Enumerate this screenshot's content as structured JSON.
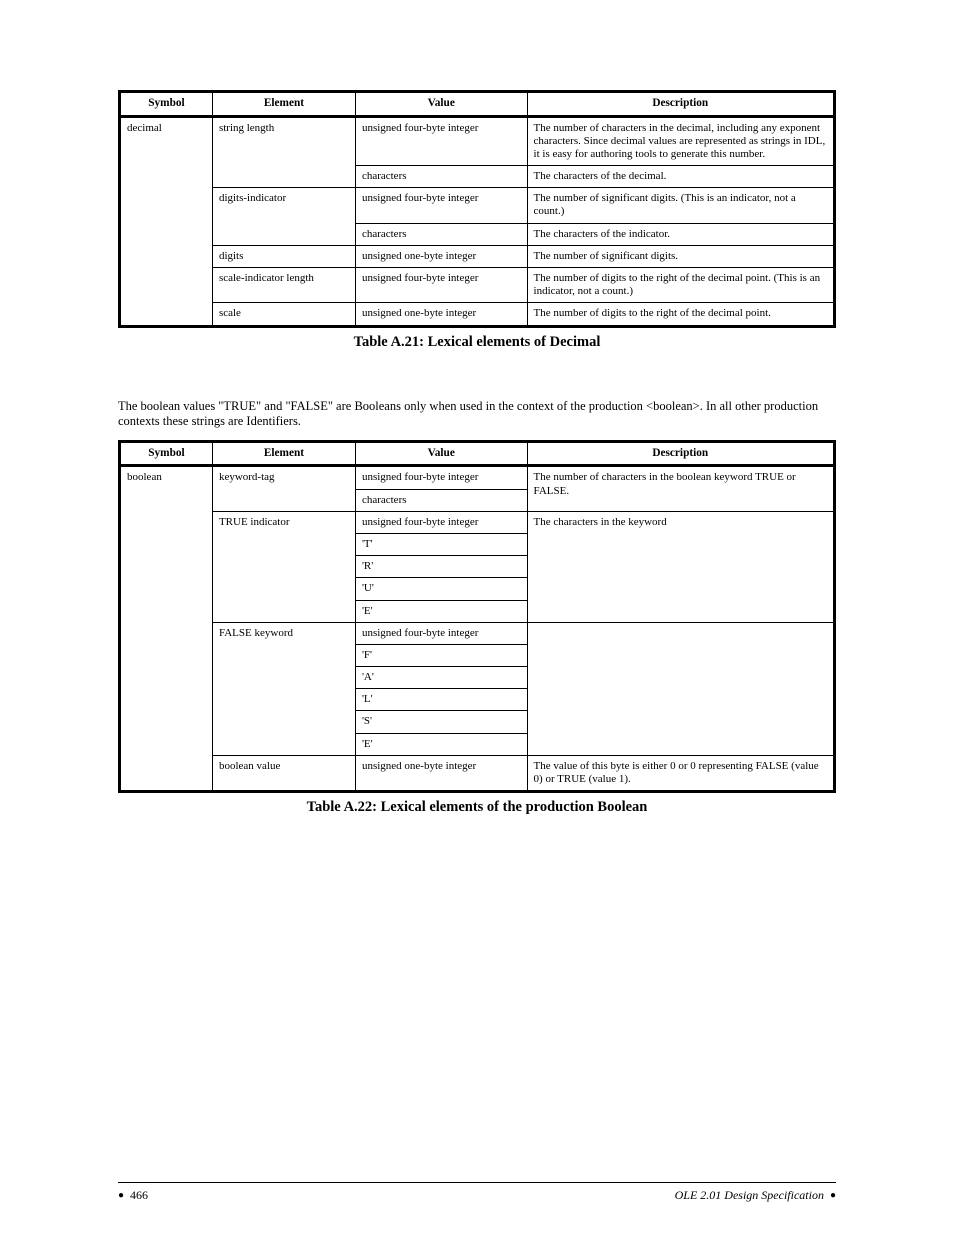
{
  "tableA": {
    "title": "Table A.21: Lexical elements of Decimal",
    "headers": [
      "Symbol",
      "Element",
      "Value",
      "Description"
    ],
    "rows": [
      {
        "symbol": "decimal",
        "cells": [
          {
            "element": "string length",
            "value": "unsigned four-byte integer",
            "desc": "The number of characters in the decimal, including any exponent characters. Since decimal values are represented as strings in IDL, it is easy for authoring tools to generate this number."
          },
          {
            "element": "",
            "value": "characters",
            "desc": "The characters of the decimal."
          }
        ]
      },
      {
        "symbol": "",
        "cells": [
          {
            "element": "digits-indicator",
            "value": "unsigned four-byte integer",
            "desc": "The number of significant digits. (This is an indicator, not a count.)"
          },
          {
            "element": "",
            "value": "characters",
            "desc": "The characters of the indicator."
          }
        ]
      },
      {
        "symbol": "",
        "cells": [
          {
            "element": "digits",
            "value": "unsigned one-byte integer",
            "desc": "The number of significant digits."
          }
        ]
      },
      {
        "symbol": "",
        "cells": [
          {
            "element": "scale-indicator length",
            "value": "unsigned four-byte integer",
            "desc": "The number of digits to the right of the decimal point. (This is an indicator, not a count.)"
          }
        ]
      },
      {
        "symbol": "",
        "cells": [
          {
            "element": "scale",
            "value": "unsigned one-byte integer",
            "desc": "The number of digits to the right of the decimal point."
          }
        ]
      }
    ]
  },
  "tableB": {
    "title": "Table A.22: Lexical elements of the production Boolean",
    "description": "The boolean values \"TRUE\" and \"FALSE\" are Booleans only when used in the context of the production <boolean>. In all other production contexts these strings are Identifiers.",
    "headers": [
      "Symbol",
      "Element",
      "Value",
      "Description"
    ],
    "rows": [
      {
        "symbol": "boolean",
        "blocks": [
          {
            "element": "keyword-tag",
            "values": [
              "unsigned four-byte integer",
              "characters"
            ],
            "desc": "The number of characters in the boolean keyword TRUE or FALSE."
          },
          {
            "element": "TRUE indicator",
            "values": [
              "unsigned four-byte integer",
              "'T'",
              "'R'",
              "'U'",
              "'E'"
            ],
            "desc": "The characters in the keyword"
          },
          {
            "element": "FALSE keyword",
            "values": [
              "unsigned four-byte integer",
              "'F'",
              "'A'",
              "'L'",
              "'S'",
              "'E'"
            ],
            "desc": ""
          },
          {
            "element": "boolean value",
            "values": [
              "unsigned one-byte integer"
            ],
            "desc": "The value of this byte is either 0 or 0 representing FALSE (value 0) or TRUE (value 1)."
          }
        ]
      }
    ]
  },
  "footer": {
    "left": "466",
    "right": "OLE 2.01 Design Specification"
  }
}
